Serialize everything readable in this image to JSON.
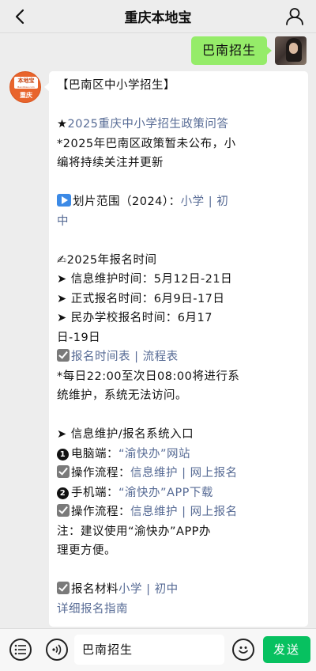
{
  "header": {
    "title": "重庆本地宝"
  },
  "outgoing": {
    "text": "巴南招生"
  },
  "bot_avatar": {
    "logo_text": "本地宝",
    "logo_sub": "Bendibao.com",
    "city": "重庆"
  },
  "message": {
    "title": "【巴南区中小学招生】",
    "policy_link": "2025重庆中小学招生政策问答",
    "policy_note_l1": "*2025年巴南区政策暂未公布，小",
    "policy_note_l2": "编将持续关注并更新",
    "range_label": "划片范围（2024）：",
    "range_link1": "小学",
    "range_link2_l1": "初",
    "range_link2_l2": "中",
    "signup_heading": "2025年报名时间",
    "maintain_time": "信息维护时间：5月12日-21日",
    "formal_time": "正式报名时间：6月9日-17日",
    "private_time_l1": "民办学校报名时间：6月17",
    "private_time_l2": "日-19日",
    "schedule_link": "报名时间表",
    "flow_link": "流程表",
    "maintenance_note_l1": "*每日22:00至次日08:00将进行系",
    "maintenance_note_l2": "统维护，系统无法访问。",
    "entry_heading": "信息维护/报名系统入口",
    "pc_label": "电脑端：",
    "pc_link": "“渝快办”网站",
    "op_label": "操作流程：",
    "info_link": "信息维护",
    "signup_link": "网上报名",
    "mobile_label": "手机端：",
    "mobile_link": "“渝快办”APP下载",
    "note_l1": "注：建议使用“渝快办”APP办",
    "note_l2": "理更方便。",
    "materials_label": "报名材料",
    "materials_link1": "小学",
    "materials_link2": "初中",
    "guide_link": "详细报名指南",
    "bullet_1": "1",
    "bullet_2": "2"
  },
  "input": {
    "text": "巴南招生"
  },
  "send_button": {
    "label": "发送"
  },
  "colors": {
    "link": "#576b95",
    "send": "#07c160",
    "bubble_out": "#95ec69"
  }
}
